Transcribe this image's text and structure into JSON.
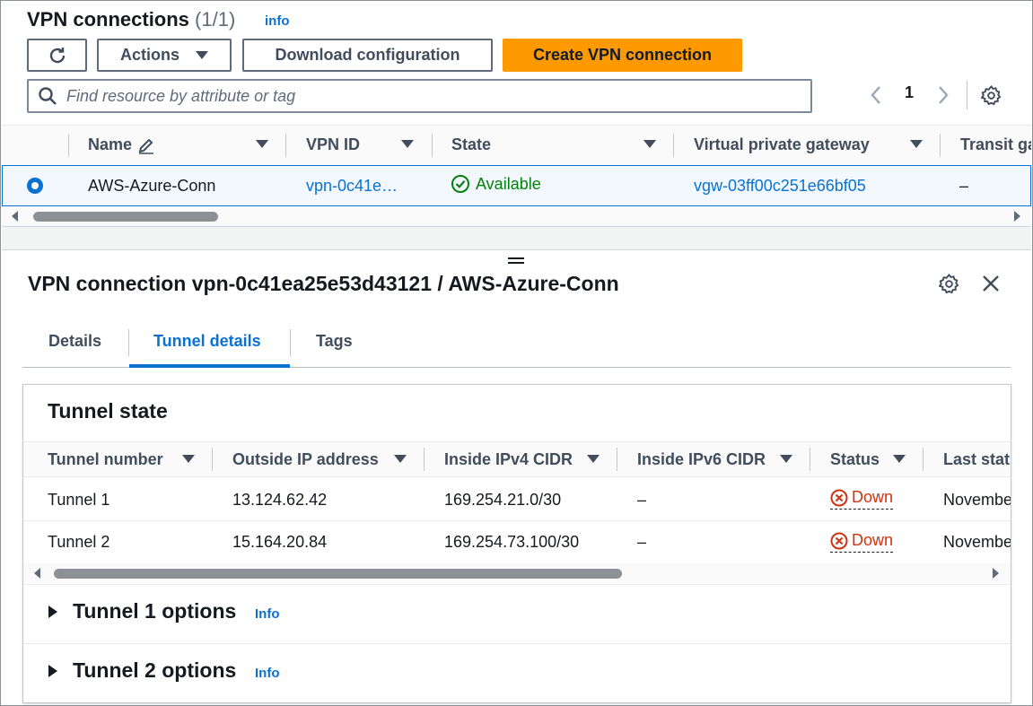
{
  "top": {
    "title": "VPN connections",
    "count": "(1/1)",
    "info": "info",
    "buttons": {
      "actions": "Actions",
      "download": "Download configuration",
      "create": "Create VPN connection"
    },
    "search_placeholder": "Find resource by attribute or tag",
    "page_number": "1"
  },
  "table": {
    "columns": [
      "Name",
      "VPN ID",
      "State",
      "Virtual private gateway",
      "Transit ga"
    ],
    "row": {
      "name": "AWS-Azure-Conn",
      "vpn_id": "vpn-0c41e…",
      "state": "Available",
      "vgw": "vgw-03ff00c251e66bf05",
      "transit": "–"
    }
  },
  "split": {
    "title": "VPN connection vpn-0c41ea25e53d43121 / AWS-Azure-Conn",
    "tabs": [
      "Details",
      "Tunnel details",
      "Tags"
    ],
    "active_tab": "Tunnel details",
    "tunnel_state": {
      "title": "Tunnel state",
      "columns": [
        "Tunnel number",
        "Outside IP address",
        "Inside IPv4 CIDR",
        "Inside IPv6 CIDR",
        "Status",
        "Last stat"
      ],
      "rows": [
        {
          "tunnel": "Tunnel 1",
          "outside_ip": "13.124.62.42",
          "ipv4": "169.254.21.0/30",
          "ipv6": "–",
          "status": "Down",
          "last": "Novembe"
        },
        {
          "tunnel": "Tunnel 2",
          "outside_ip": "15.164.20.84",
          "ipv4": "169.254.73.100/30",
          "ipv6": "–",
          "status": "Down",
          "last": "Novembe"
        }
      ]
    },
    "options": [
      {
        "title": "Tunnel 1 options",
        "info": "Info"
      },
      {
        "title": "Tunnel 2 options",
        "info": "Info"
      }
    ]
  },
  "colors": {
    "primary_button": "#ff9900",
    "link": "#0972d3",
    "available": "#037f0c",
    "down": "#d13212"
  }
}
